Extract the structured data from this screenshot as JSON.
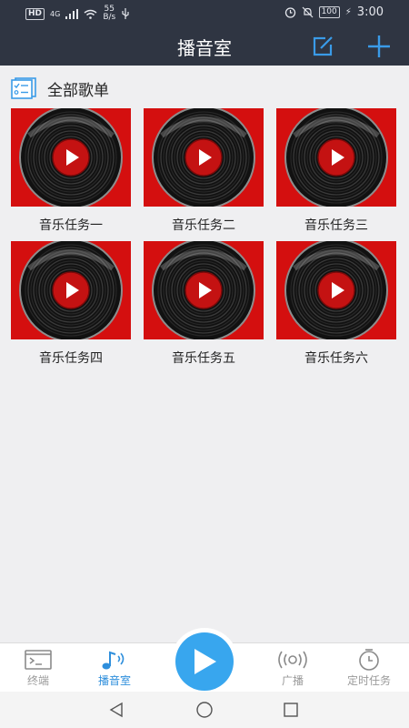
{
  "status_bar": {
    "hd": "HD",
    "signal_type": "4G",
    "net_speed_value": "55",
    "net_speed_unit": "B/s",
    "battery": "100",
    "time": "3:00"
  },
  "header": {
    "title": "播音室",
    "edit_icon": "edit-icon",
    "add_icon": "plus-icon"
  },
  "section": {
    "label": "全部歌单",
    "icon": "playlist-icon"
  },
  "playlists": [
    {
      "label": "音乐任务一"
    },
    {
      "label": "音乐任务二"
    },
    {
      "label": "音乐任务三"
    },
    {
      "label": "音乐任务四"
    },
    {
      "label": "音乐任务五"
    },
    {
      "label": "音乐任务六"
    }
  ],
  "bottom_nav": {
    "items": [
      {
        "label": "终端",
        "icon": "terminal-icon"
      },
      {
        "label": "播音室",
        "icon": "music-note-icon"
      },
      {
        "label": "广播",
        "icon": "broadcast-icon"
      },
      {
        "label": "定时任务",
        "icon": "timer-icon"
      }
    ],
    "active_index": 1
  },
  "colors": {
    "header_bg": "#2f3542",
    "accent": "#2f8fdc",
    "play_button": "#38a6ee",
    "thumb_bg": "#d40f0f"
  }
}
